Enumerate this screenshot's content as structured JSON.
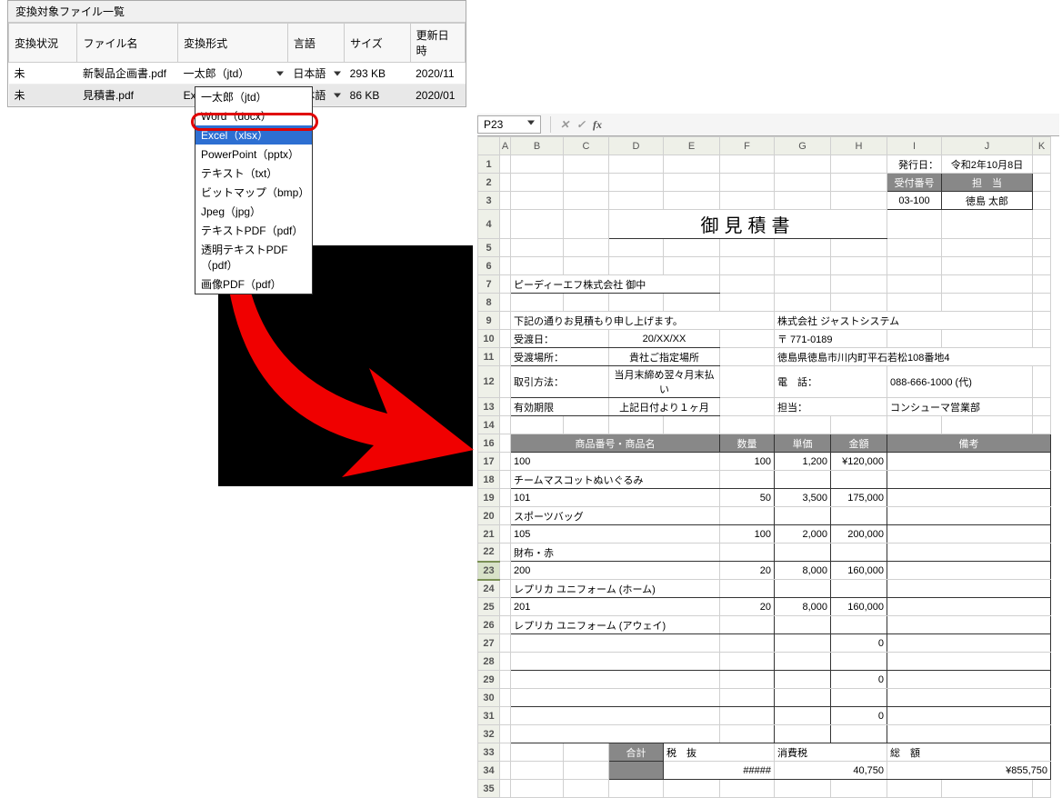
{
  "filePanel": {
    "title": "変換対象ファイル一覧",
    "headers": {
      "status": "変換状況",
      "name": "ファイル名",
      "format": "変換形式",
      "lang": "言語",
      "size": "サイズ",
      "date": "更新日時"
    },
    "rows": [
      {
        "status": "未",
        "name": "新製品企画書.pdf",
        "format": "一太郎（jtd）",
        "lang": "日本語",
        "size": "293 KB",
        "date": "2020/11"
      },
      {
        "status": "未",
        "name": "見積書.pdf",
        "format": "Excel（xlsx）",
        "lang": "日本語",
        "size": "86 KB",
        "date": "2020/01"
      }
    ]
  },
  "dropdown": {
    "items": [
      "一太郎（jtd）",
      "Word（docx）",
      "Excel（xlsx）",
      "PowerPoint（pptx）",
      "テキスト（txt）",
      "ビットマップ（bmp）",
      "Jpeg（jpg）",
      "テキストPDF（pdf）",
      "透明テキストPDF（pdf）",
      "画像PDF（pdf）"
    ],
    "selectedIndex": 2
  },
  "formulaBar": {
    "cellRef": "P23",
    "formula": ""
  },
  "gridCols": [
    "A",
    "B",
    "C",
    "D",
    "E",
    "F",
    "G",
    "H",
    "I",
    "J",
    "K"
  ],
  "quote": {
    "issueDateLabel": "発行日：",
    "issueDate": "令和2年10月8日",
    "receiptLabel": "受付番号",
    "personLabel": "担　当",
    "receiptNo": "03-100",
    "person": "徳島 太郎",
    "title": "御見積書",
    "addressee": "ピーディーエフ株式会社 御中",
    "intro": "下記の通りお見積もり申し上げます。",
    "company": "株式会社  ジャストシステム",
    "deliveryDateLabel": "受渡日：",
    "deliveryDate": "20/XX/XX",
    "zipLabel": "〒 771-0189",
    "deliveryPlaceLabel": "受渡場所：",
    "deliveryPlace": "貴社ご指定場所",
    "address": "徳島県徳島市川内町平石若松108番地4",
    "paymentLabel": "取引方法：",
    "payment": "当月末締め翌々月末払い",
    "telLabel": "電　話：",
    "tel": "088-666-1000 (代)",
    "validLabel": "有効期限",
    "valid": "上記日付より１ヶ月",
    "deptLabel": "担当：",
    "dept": "コンシューマ営業部",
    "tableHeaders": {
      "prod": "商品番号・商品名",
      "qty": "数量",
      "unit": "単価",
      "amount": "金額",
      "note": "備考"
    },
    "items": [
      {
        "code": "100",
        "name": "チームマスコットぬいぐるみ",
        "qty": "100",
        "unit": "1,200",
        "amount": "¥120,000"
      },
      {
        "code": "101",
        "name": "スポーツバッグ",
        "qty": "50",
        "unit": "3,500",
        "amount": "175,000"
      },
      {
        "code": "105",
        "name": "財布・赤",
        "qty": "100",
        "unit": "2,000",
        "amount": "200,000"
      },
      {
        "code": "200",
        "name": "レプリカ ユニフォーム (ホーム)",
        "qty": "20",
        "unit": "8,000",
        "amount": "160,000"
      },
      {
        "code": "201",
        "name": "レプリカ ユニフォーム (アウェイ)",
        "qty": "20",
        "unit": "8,000",
        "amount": "160,000"
      }
    ],
    "zeros": [
      "0",
      "0",
      "0"
    ],
    "totalsLabel": "合計",
    "subtotalLabel": "税　抜",
    "subtotal": "#####",
    "taxLabel": "消費税",
    "tax": "40,750",
    "grandLabel": "総　額",
    "grand": "¥855,750"
  }
}
